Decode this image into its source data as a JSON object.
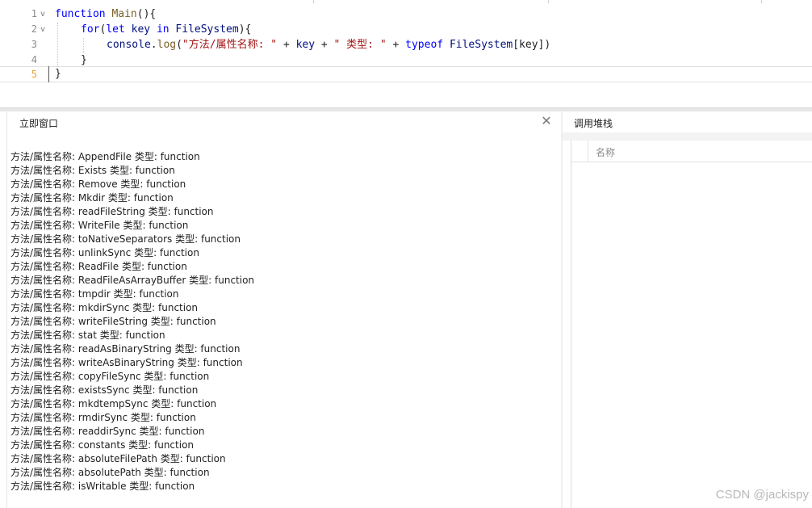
{
  "editor": {
    "lines": [
      {
        "n": "1",
        "fold": "v"
      },
      {
        "n": "2",
        "fold": "v"
      },
      {
        "n": "3",
        "fold": ""
      },
      {
        "n": "4",
        "fold": ""
      },
      {
        "n": "5",
        "fold": ""
      }
    ],
    "code": {
      "l1_kw": "function",
      "l1_name": " Main",
      "l1_rest": "(){",
      "l2_kw": "for",
      "l2_open": "(",
      "l2_let": "let",
      "l2_key": " key ",
      "l2_in": "in",
      "l2_obj": " FileSystem",
      "l2_close": "){",
      "l3_console": "console",
      "l3_dot": ".",
      "l3_log": "log",
      "l3_paren": "(",
      "l3_str1": "\"方法/属性名称: \"",
      "l3_plus1": " + ",
      "l3_key1": "key",
      "l3_plus2": " + ",
      "l3_str2": "\" 类型: \"",
      "l3_plus3": " + ",
      "l3_typeof": "typeof",
      "l3_obj": " FileSystem",
      "l3_idx": "[key])",
      "l4": "}",
      "l5": "}"
    }
  },
  "immediate": {
    "title": "立即窗口",
    "output": [
      "方法/属性名称: AppendFile 类型: function",
      "方法/属性名称: Exists 类型: function",
      "方法/属性名称: Remove 类型: function",
      "方法/属性名称: Mkdir 类型: function",
      "方法/属性名称: readFileString 类型: function",
      "方法/属性名称: WriteFile 类型: function",
      "方法/属性名称: toNativeSeparators 类型: function",
      "方法/属性名称: unlinkSync 类型: function",
      "方法/属性名称: ReadFile 类型: function",
      "方法/属性名称: ReadFileAsArrayBuffer 类型: function",
      "方法/属性名称: tmpdir 类型: function",
      "方法/属性名称: mkdirSync 类型: function",
      "方法/属性名称: writeFileString 类型: function",
      "方法/属性名称: stat 类型: function",
      "方法/属性名称: readAsBinaryString 类型: function",
      "方法/属性名称: writeAsBinaryString 类型: function",
      "方法/属性名称: copyFileSync 类型: function",
      "方法/属性名称: existsSync 类型: function",
      "方法/属性名称: mkdtempSync 类型: function",
      "方法/属性名称: rmdirSync 类型: function",
      "方法/属性名称: readdirSync 类型: function",
      "方法/属性名称: constants 类型: function",
      "方法/属性名称: absoluteFilePath 类型: function",
      "方法/属性名称: absolutePath 类型: function",
      "方法/属性名称: isWritable 类型: function"
    ]
  },
  "callstack": {
    "title": "调用堆栈",
    "column_name": "名称"
  },
  "watermark": "CSDN @jackispy"
}
